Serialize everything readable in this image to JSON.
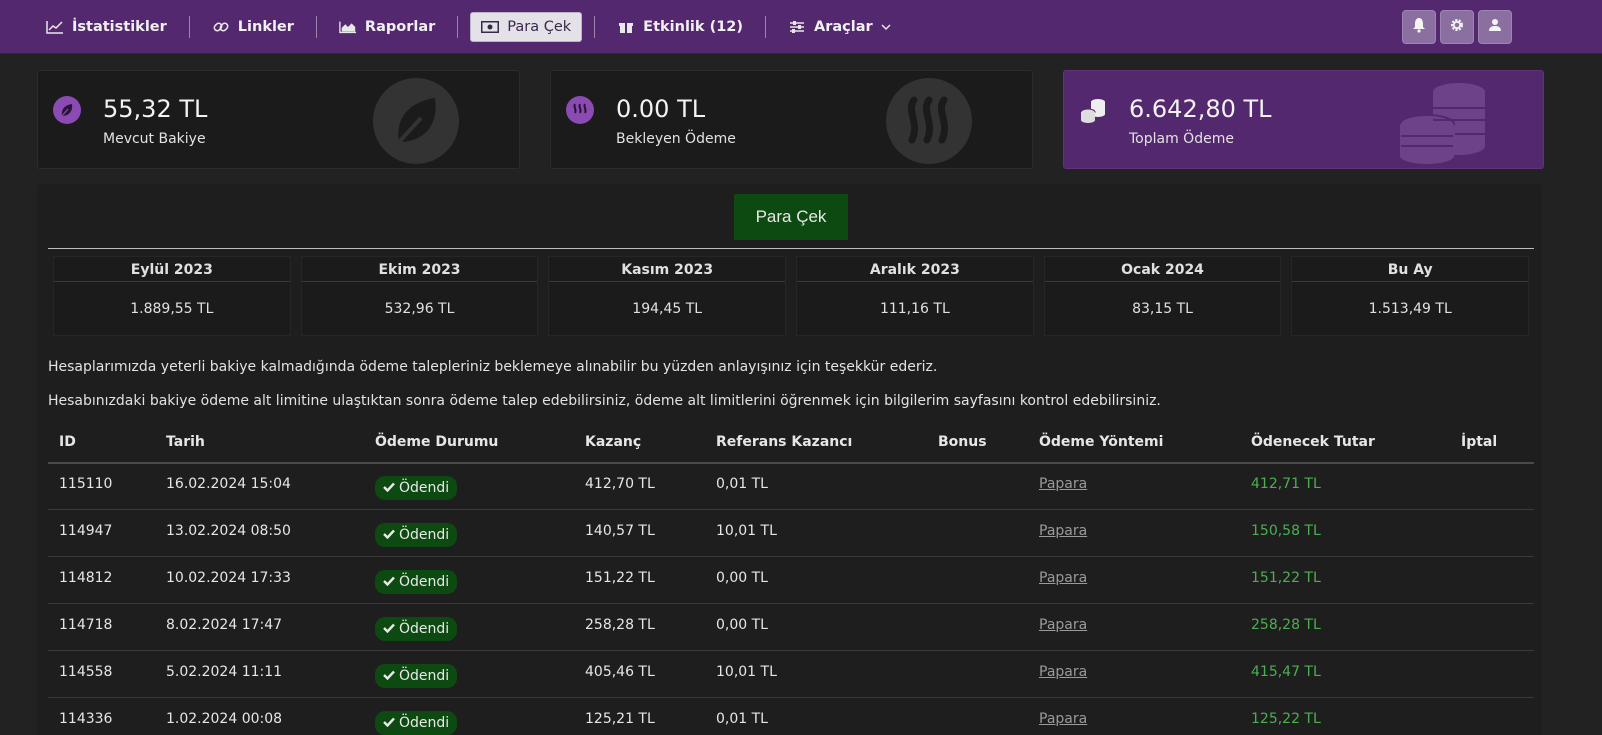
{
  "nav": {
    "items": [
      {
        "label": "İstatistikler",
        "icon": "chart-line-icon"
      },
      {
        "label": "Linkler",
        "icon": "link-icon"
      },
      {
        "label": "Raporlar",
        "icon": "area-chart-icon"
      },
      {
        "label": "Para Çek",
        "icon": "money-icon",
        "active": true
      },
      {
        "label": "Etkinlik (12)",
        "icon": "gift-icon"
      },
      {
        "label": "Araçlar",
        "icon": "sliders-icon",
        "dropdown": true
      }
    ],
    "right_buttons": [
      "bell-icon",
      "gear-icon",
      "user-icon"
    ]
  },
  "cards": [
    {
      "value": "55,32 TL",
      "label": "Mevcut Bakiye",
      "icon": "leaf-icon"
    },
    {
      "value": "0.00 TL",
      "label": "Bekleyen Ödeme",
      "icon": "steem-icon"
    },
    {
      "value": "6.642,80 TL",
      "label": "Toplam Ödeme",
      "icon": "coins-icon"
    }
  ],
  "withdraw_button": "Para Çek",
  "months": [
    {
      "name": "Eylül 2023",
      "value": "1.889,55 TL"
    },
    {
      "name": "Ekim 2023",
      "value": "532,96 TL"
    },
    {
      "name": "Kasım 2023",
      "value": "194,45 TL"
    },
    {
      "name": "Aralık 2023",
      "value": "111,16 TL"
    },
    {
      "name": "Ocak 2024",
      "value": "83,15 TL"
    },
    {
      "name": "Bu Ay",
      "value": "1.513,49 TL"
    }
  ],
  "notices": [
    "Hesaplarımızda yeterli bakiye kalmadığında ödeme talepleriniz beklemeye alınabilir bu yüzden anlayışınız için teşekkür ederiz.",
    "Hesabınızdaki bakiye ödeme alt limitine ulaştıktan sonra ödeme talep edebilirsiniz, ödeme alt limitlerini öğrenmek için bilgilerim sayfasını kontrol edebilirsiniz."
  ],
  "table": {
    "headers": [
      "ID",
      "Tarih",
      "Ödeme Durumu",
      "Kazanç",
      "Referans Kazancı",
      "Bonus",
      "Ödeme Yöntemi",
      "Ödenecek Tutar",
      "İptal"
    ],
    "rows": [
      {
        "id": "115110",
        "date": "16.02.2024 15:04",
        "status": "Ödendi",
        "earning": "412,70 TL",
        "ref": "0,01 TL",
        "bonus": "",
        "method": "Papara",
        "amount": "412,71 TL"
      },
      {
        "id": "114947",
        "date": "13.02.2024 08:50",
        "status": "Ödendi",
        "earning": "140,57 TL",
        "ref": "10,01 TL",
        "bonus": "",
        "method": "Papara",
        "amount": "150,58 TL"
      },
      {
        "id": "114812",
        "date": "10.02.2024 17:33",
        "status": "Ödendi",
        "earning": "151,22 TL",
        "ref": "0,00 TL",
        "bonus": "",
        "method": "Papara",
        "amount": "151,22 TL"
      },
      {
        "id": "114718",
        "date": "8.02.2024 17:47",
        "status": "Ödendi",
        "earning": "258,28 TL",
        "ref": "0,00 TL",
        "bonus": "",
        "method": "Papara",
        "amount": "258,28 TL"
      },
      {
        "id": "114558",
        "date": "5.02.2024 11:11",
        "status": "Ödendi",
        "earning": "405,46 TL",
        "ref": "10,01 TL",
        "bonus": "",
        "method": "Papara",
        "amount": "415,47 TL"
      },
      {
        "id": "114336",
        "date": "1.02.2024 00:08",
        "status": "Ödendi",
        "earning": "125,21 TL",
        "ref": "0,01 TL",
        "bonus": "",
        "method": "Papara",
        "amount": "125,22 TL"
      }
    ]
  },
  "colors": {
    "navbar": "#54286f",
    "background": "#222222",
    "paid_badge": "#0d4a12",
    "amount_green": "#4caf50"
  }
}
